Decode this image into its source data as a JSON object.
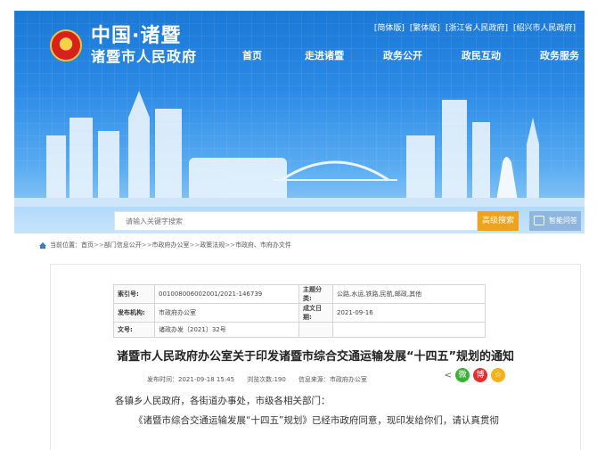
{
  "header": {
    "logo_cn": "中国·诸暨",
    "logo_sub": "诸暨市人民政府",
    "top_links": [
      "[简体版]",
      "[繁体版]",
      "[浙江省人民政府]",
      "[绍兴市人民政府]"
    ],
    "nav": [
      "首页",
      "走进诸暨",
      "政务公开",
      "政民互动",
      "政务服务"
    ]
  },
  "search": {
    "placeholder": "请输入关键字搜索",
    "advanced_label": "高级搜索",
    "smart_label": "智能问答"
  },
  "breadcrumb": {
    "prefix": "当前位置：",
    "items": [
      "首页",
      "部门信息公开",
      "市政府办公室",
      "政策法规",
      "市政府、市府办文件"
    ],
    "sep": ">>"
  },
  "meta": {
    "index_label": "索引号:",
    "index_value": "001008006002001/2021-146739",
    "subject_label": "主题分类:",
    "subject_value": "公路,水运,铁路,民航,邮政,其他",
    "issuer_label": "发布机构:",
    "issuer_value": "市政府办公室",
    "date_label": "成文日期:",
    "date_value": "2021-09-16",
    "docno_label": "文号:",
    "docno_value": "诸政办发〔2021〕32号"
  },
  "article": {
    "title": "诸暨市人民政府办公室关于印发诸暨市综合交通运输发展“十四五”规划的通知",
    "publish_time": "发布时间：2021-09-18 15:45",
    "views": "浏览次数:190",
    "source": "信息来源：市政府办公室",
    "greeting": "各镇乡人民政府，各街道办事处，市级各相关部门：",
    "paragraph": "《诸暨市综合交通运输发展“十四五”规划》已经市政府同意，现印发给你们，请认真贯彻"
  },
  "share": {
    "wechat": "微",
    "weibo": "博",
    "qzone": "☆"
  }
}
